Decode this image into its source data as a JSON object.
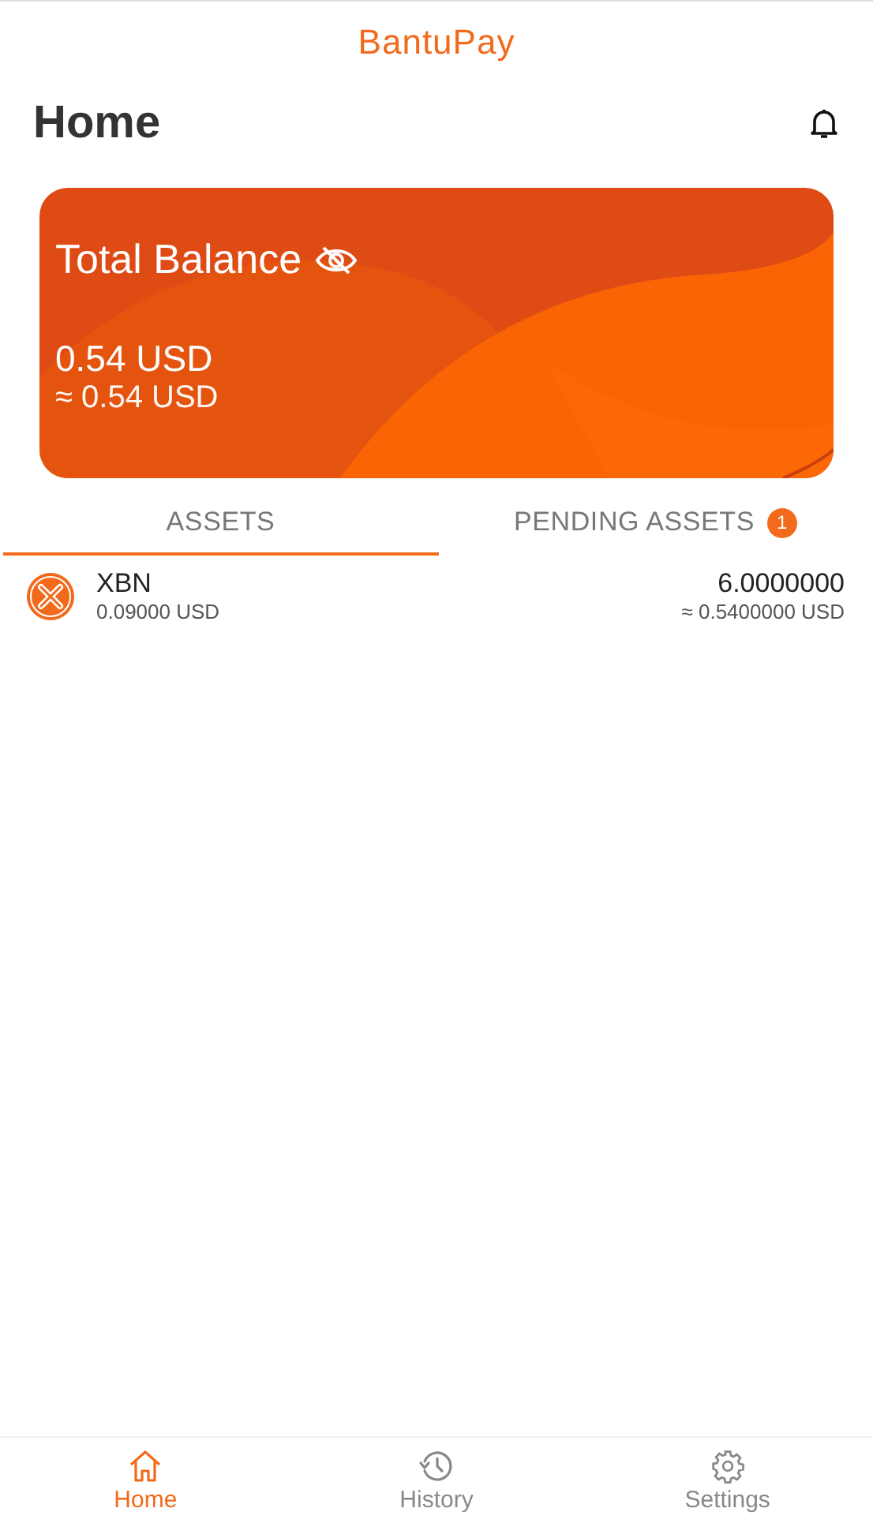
{
  "app_title": "BantuPay",
  "page_title": "Home",
  "balance_card": {
    "title": "Total Balance",
    "amount": "0.54 USD",
    "approx": "≈ 0.54 USD",
    "hidden_toggle": false
  },
  "tabs": [
    {
      "label": "ASSETS",
      "selected": true
    },
    {
      "label": "PENDING ASSETS",
      "selected": false,
      "badge": "1"
    }
  ],
  "assets": [
    {
      "name": "XBN",
      "price": "0.09000 USD",
      "amount": "6.0000000",
      "value": "≈ 0.5400000 USD"
    }
  ],
  "bottom_nav": [
    {
      "label": "Home",
      "kind": "home",
      "selected": true
    },
    {
      "label": "History",
      "kind": "history",
      "selected": false
    },
    {
      "label": "Settings",
      "kind": "settings",
      "selected": false
    }
  ]
}
